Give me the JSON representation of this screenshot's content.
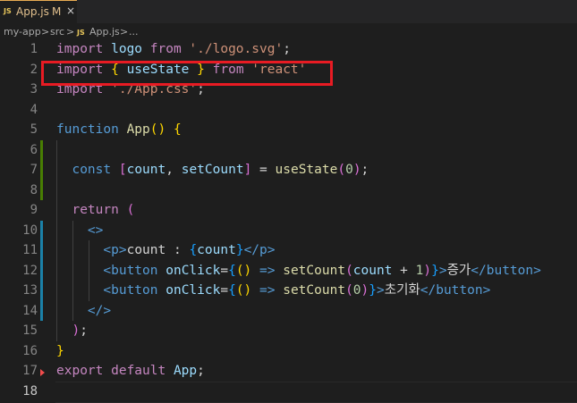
{
  "tab": {
    "lang_icon": "JS",
    "file_name": "App.js",
    "modified_badge": "M",
    "close_glyph": "×"
  },
  "breadcrumb": {
    "items": [
      "my-app",
      "src",
      "App.js",
      "..."
    ],
    "separator": ">",
    "file_icon": "JS"
  },
  "editor": {
    "lines": [
      {
        "n": "1",
        "tokens": [
          [
            "kw",
            "import "
          ],
          [
            "var",
            "logo "
          ],
          [
            "kw",
            "from "
          ],
          [
            "str",
            "'./logo.svg'"
          ],
          [
            "punc",
            ";"
          ]
        ]
      },
      {
        "n": "2",
        "tokens": [
          [
            "kw",
            "import "
          ],
          [
            "br1",
            "{ "
          ],
          [
            "var",
            "useState "
          ],
          [
            "br1",
            "} "
          ],
          [
            "kw",
            "from "
          ],
          [
            "str",
            "'react'"
          ]
        ]
      },
      {
        "n": "3",
        "tokens": [
          [
            "kw",
            "import "
          ],
          [
            "str",
            "'./App.css'"
          ],
          [
            "punc",
            ";"
          ]
        ]
      },
      {
        "n": "4",
        "tokens": []
      },
      {
        "n": "5",
        "tokens": [
          [
            "kwb",
            "function "
          ],
          [
            "fn",
            "App"
          ],
          [
            "br1",
            "() {"
          ]
        ]
      },
      {
        "n": "6",
        "tokens": []
      },
      {
        "n": "7",
        "tokens": [
          [
            "txt",
            "  "
          ],
          [
            "kwb",
            "const "
          ],
          [
            "br2",
            "["
          ],
          [
            "var",
            "count"
          ],
          [
            "punc",
            ", "
          ],
          [
            "var",
            "setCount"
          ],
          [
            "br2",
            "]"
          ],
          [
            "punc",
            " = "
          ],
          [
            "fn",
            "useState"
          ],
          [
            "br2",
            "("
          ],
          [
            "num",
            "0"
          ],
          [
            "br2",
            ")"
          ],
          [
            "punc",
            ";"
          ]
        ]
      },
      {
        "n": "8",
        "tokens": []
      },
      {
        "n": "9",
        "tokens": [
          [
            "txt",
            "  "
          ],
          [
            "kw",
            "return "
          ],
          [
            "br2",
            "("
          ]
        ]
      },
      {
        "n": "10",
        "tokens": [
          [
            "txt",
            "    "
          ],
          [
            "tag",
            "<>"
          ]
        ]
      },
      {
        "n": "11",
        "tokens": [
          [
            "txt",
            "      "
          ],
          [
            "tag",
            "<p>"
          ],
          [
            "txt",
            "count : "
          ],
          [
            "br3",
            "{"
          ],
          [
            "var",
            "count"
          ],
          [
            "br3",
            "}"
          ],
          [
            "tag",
            "</p>"
          ]
        ]
      },
      {
        "n": "12",
        "tokens": [
          [
            "txt",
            "      "
          ],
          [
            "tag",
            "<button "
          ],
          [
            "var",
            "onClick"
          ],
          [
            "punc",
            "="
          ],
          [
            "br3",
            "{"
          ],
          [
            "br1",
            "() "
          ],
          [
            "kwb",
            "=> "
          ],
          [
            "fn",
            "setCount"
          ],
          [
            "br2",
            "("
          ],
          [
            "var",
            "count"
          ],
          [
            "punc",
            " + "
          ],
          [
            "num",
            "1"
          ],
          [
            "br2",
            ")"
          ],
          [
            "br3",
            "}"
          ],
          [
            "tag",
            ">"
          ],
          [
            "txt",
            "증가"
          ],
          [
            "tag",
            "</button>"
          ]
        ]
      },
      {
        "n": "13",
        "tokens": [
          [
            "txt",
            "      "
          ],
          [
            "tag",
            "<button "
          ],
          [
            "var",
            "onClick"
          ],
          [
            "punc",
            "="
          ],
          [
            "br3",
            "{"
          ],
          [
            "br1",
            "() "
          ],
          [
            "kwb",
            "=> "
          ],
          [
            "fn",
            "setCount"
          ],
          [
            "br2",
            "("
          ],
          [
            "num",
            "0"
          ],
          [
            "br2",
            ")"
          ],
          [
            "br3",
            "}"
          ],
          [
            "tag",
            ">"
          ],
          [
            "txt",
            "초기화"
          ],
          [
            "tag",
            "</button>"
          ]
        ]
      },
      {
        "n": "14",
        "tokens": [
          [
            "txt",
            "    "
          ],
          [
            "tag",
            "</>"
          ]
        ]
      },
      {
        "n": "15",
        "tokens": [
          [
            "txt",
            "  "
          ],
          [
            "br2",
            ")"
          ],
          [
            "punc",
            ";"
          ]
        ]
      },
      {
        "n": "16",
        "tokens": [
          [
            "br1",
            "}"
          ]
        ]
      },
      {
        "n": "17",
        "tokens": [
          [
            "kw",
            "export "
          ],
          [
            "kw",
            "default "
          ],
          [
            "var",
            "App"
          ],
          [
            "punc",
            ";"
          ]
        ]
      },
      {
        "n": "18",
        "tokens": []
      }
    ],
    "active_line": "18"
  },
  "colors": {
    "keyword": "#c586c0",
    "storage": "#569cd6",
    "string": "#ce9178",
    "variable": "#9cdcfe",
    "function": "#dcdcaa",
    "number": "#b5cea8",
    "highlight_box": "#e81b23",
    "git_added": "#487e02",
    "git_modified": "#1b81a8"
  }
}
